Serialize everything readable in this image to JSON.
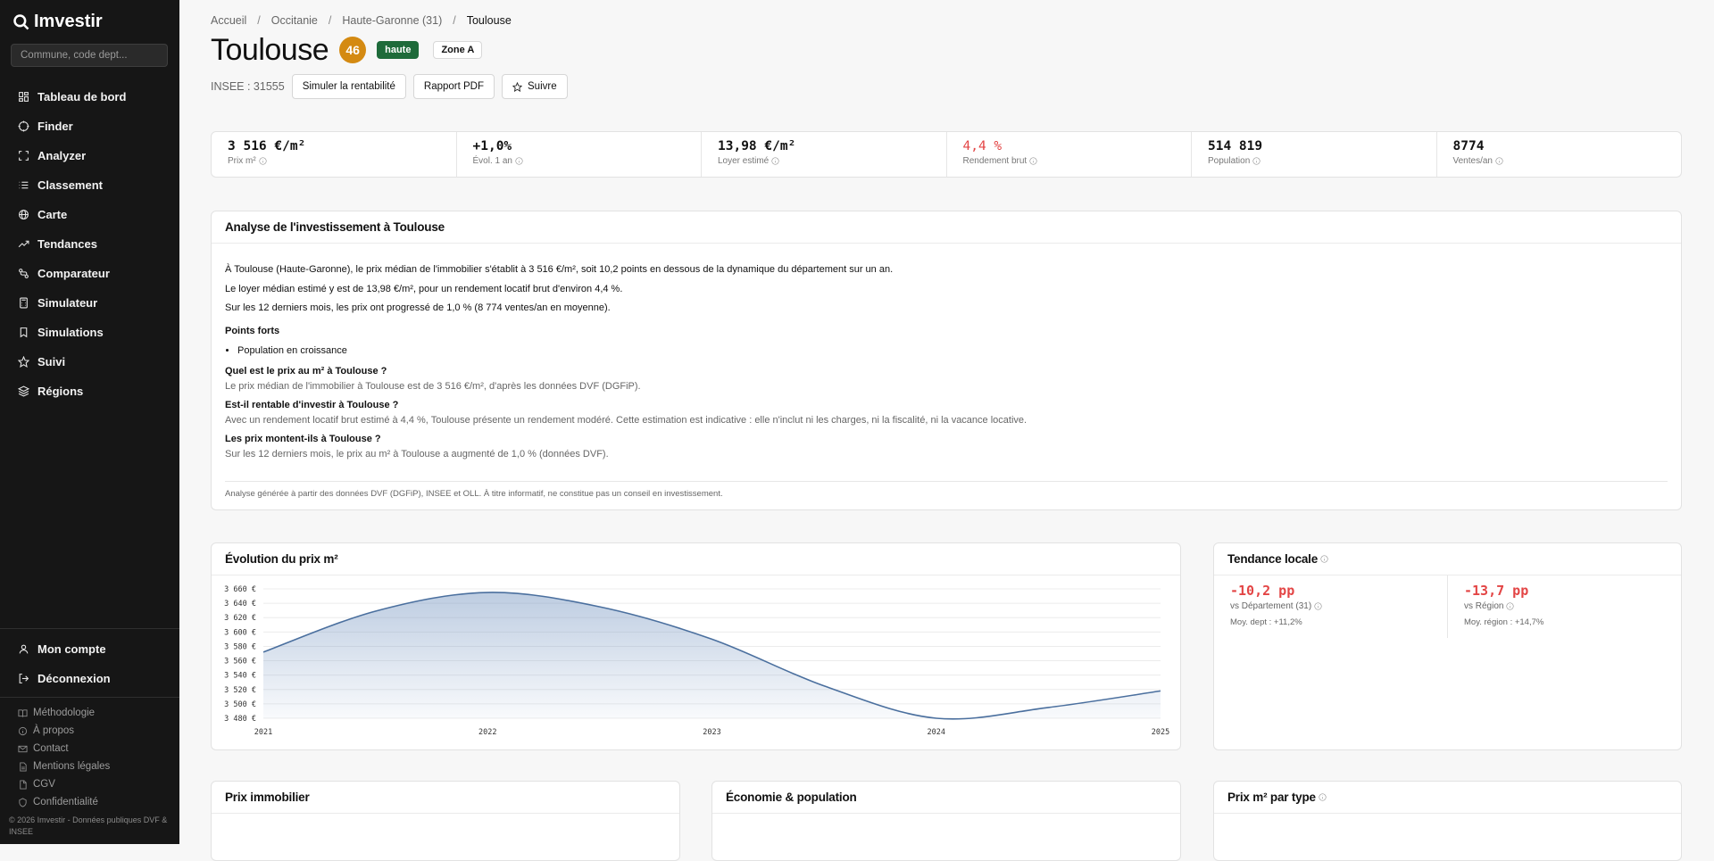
{
  "app": {
    "name": "Imvestir"
  },
  "sidebar": {
    "search_placeholder": "Commune, code dept...",
    "items": [
      {
        "label": "Tableau de bord",
        "icon": "dashboard-icon"
      },
      {
        "label": "Finder",
        "icon": "target-icon"
      },
      {
        "label": "Analyzer",
        "icon": "scan-icon"
      },
      {
        "label": "Classement",
        "icon": "list-icon"
      },
      {
        "label": "Carte",
        "icon": "globe-icon"
      },
      {
        "label": "Tendances",
        "icon": "trend-icon"
      },
      {
        "label": "Comparateur",
        "icon": "compare-icon"
      },
      {
        "label": "Simulateur",
        "icon": "calculator-icon"
      },
      {
        "label": "Simulations",
        "icon": "bookmark-icon"
      },
      {
        "label": "Suivi",
        "icon": "star-icon"
      },
      {
        "label": "Régions",
        "icon": "layers-icon"
      }
    ],
    "account": [
      {
        "label": "Mon compte",
        "icon": "user-icon"
      },
      {
        "label": "Déconnexion",
        "icon": "logout-icon"
      }
    ],
    "footer_links": [
      {
        "label": "Méthodologie",
        "icon": "book-icon"
      },
      {
        "label": "À propos",
        "icon": "info-icon"
      },
      {
        "label": "Contact",
        "icon": "mail-icon"
      },
      {
        "label": "Mentions légales",
        "icon": "document-icon"
      },
      {
        "label": "CGV",
        "icon": "file-icon"
      },
      {
        "label": "Confidentialité",
        "icon": "shield-icon"
      }
    ],
    "copyright": "© 2026 Imvestir - Données publiques DVF & INSEE"
  },
  "breadcrumb": [
    "Accueil",
    "Occitanie",
    "Haute-Garonne (31)",
    "Toulouse"
  ],
  "header": {
    "title": "Toulouse",
    "score": "46",
    "badge": "haute",
    "zone": "Zone A",
    "insee": "INSEE : 31555",
    "btn_simulate": "Simuler la rentabilité",
    "btn_pdf": "Rapport PDF",
    "btn_follow": "Suivre"
  },
  "stats": [
    {
      "value": "3 516 €/m²",
      "label": "Prix m²"
    },
    {
      "value": "+1,0%",
      "label": "Évol. 1 an"
    },
    {
      "value": "13,98 €/m²",
      "label": "Loyer estimé"
    },
    {
      "value": "4,4 %",
      "label": "Rendement brut"
    },
    {
      "value": "514 819",
      "label": "Population"
    },
    {
      "value": "8774",
      "label": "Ventes/an"
    }
  ],
  "analysis": {
    "title": "Analyse de l'investissement à Toulouse",
    "p1": "À Toulouse (Haute-Garonne), le prix médian de l'immobilier s'établit à 3 516 €/m², soit 10,2 points en dessous de la dynamique du département sur un an.",
    "p2": "Le loyer médian estimé y est de 13,98 €/m², pour un rendement locatif brut d'environ 4,4 %.",
    "p3": "Sur les 12 derniers mois, les prix ont progressé de 1,0 % (8 774 ventes/an en moyenne).",
    "strengths_title": "Points forts",
    "strength1": "Population en croissance",
    "q1": "Quel est le prix au m² à Toulouse ?",
    "a1": "Le prix médian de l'immobilier à Toulouse est de 3 516 €/m², d'après les données DVF (DGFiP).",
    "q2": "Est-il rentable d'investir à Toulouse ?",
    "a2": "Avec un rendement locatif brut estimé à 4,4 %, Toulouse présente un rendement modéré. Cette estimation est indicative : elle n'inclut ni les charges, ni la fiscalité, ni la vacance locative.",
    "q3": "Les prix montent-ils à Toulouse ?",
    "a3": "Sur les 12 derniers mois, le prix au m² à Toulouse a augmenté de 1,0 % (données DVF).",
    "note": "Analyse générée à partir des données DVF (DGFiP), INSEE et OLL. À titre informatif, ne constitue pas un conseil en investissement."
  },
  "evolution": {
    "title": "Évolution du prix m²"
  },
  "chart_data": {
    "type": "area",
    "title": "Évolution du prix m²",
    "x": [
      2021,
      2021.5,
      2022,
      2022.5,
      2023,
      2023.5,
      2024,
      2024.5,
      2025
    ],
    "values": [
      3572,
      3629,
      3655,
      3635,
      3590,
      3525,
      3480,
      3495,
      3518
    ],
    "x_ticks": [
      "2021",
      "2022",
      "2023",
      "2024",
      "2025"
    ],
    "y_ticks": [
      "3 660 €",
      "3 640 €",
      "3 620 €",
      "3 600 €",
      "3 580 €",
      "3 560 €",
      "3 540 €",
      "3 520 €",
      "3 500 €",
      "3 480 €"
    ],
    "ylim": [
      3480,
      3660
    ],
    "grid": true,
    "color": "#4a6f9e"
  },
  "trend": {
    "title": "Tendance locale",
    "dept_value": "-10,2 pp",
    "dept_label": "vs Département (31)",
    "dept_avg": "Moy. dept : +11,2%",
    "region_value": "-13,7 pp",
    "region_label": "vs Région",
    "region_avg": "Moy. région : +14,7%"
  },
  "bottom": {
    "prix": "Prix immobilier",
    "eco": "Économie & population",
    "type": "Prix m² par type"
  }
}
